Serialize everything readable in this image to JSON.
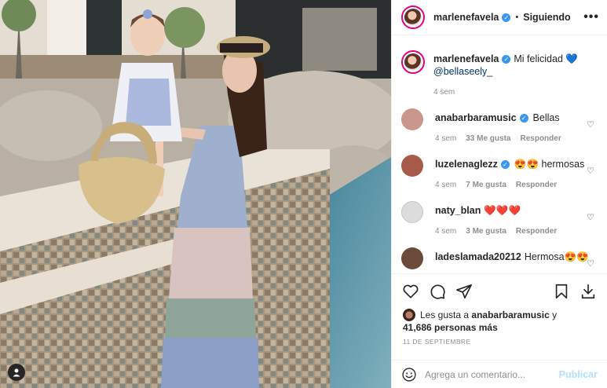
{
  "post": {
    "username": "marlenefavela",
    "follow_status": "Siguiendo",
    "more_icon": "•••",
    "separator": "•",
    "caption_text": "Mi felicidad 💙",
    "caption_mention": "@bellaseely_",
    "caption_time": "4 sem"
  },
  "comments": [
    {
      "user": "anabarbaramusic",
      "verified": true,
      "text": "Bellas",
      "time": "4 sem",
      "likes": "33 Me gusta",
      "reply": "Responder",
      "avatar_color": "#c9978b"
    },
    {
      "user": "luzelenaglezz",
      "verified": true,
      "text": "😍😍 hermosas",
      "time": "4 sem",
      "likes": "7 Me gusta",
      "reply": "Responder",
      "avatar_color": "#a85a4a"
    },
    {
      "user": "naty_blan",
      "verified": false,
      "text": "❤️❤️❤️",
      "time": "4 sem",
      "likes": "3 Me gusta",
      "reply": "Responder",
      "avatar_color": "#dcdcdc"
    },
    {
      "user": "ladeslamada20212",
      "verified": false,
      "text": "Hermosa😍😍",
      "time": "",
      "likes": "",
      "reply": "",
      "avatar_color": "#6b4a3a"
    }
  ],
  "likes": {
    "prefix": "Les gusta a",
    "liker": "anabarbaramusic",
    "joiner": "y",
    "count": "41,686 personas más"
  },
  "date": "11 DE SEPTIEMBRE",
  "add_comment": {
    "placeholder": "Agrega un comentario...",
    "publish": "Publicar"
  },
  "icons": [
    "heart-icon",
    "comment-icon",
    "share-icon",
    "bookmark-icon",
    "download-icon",
    "emoji-icon",
    "user-tag-icon"
  ],
  "colors": {
    "verified": "#3897f0",
    "publish_disabled": "#b2dffc",
    "muted": "#8e8e8e"
  }
}
